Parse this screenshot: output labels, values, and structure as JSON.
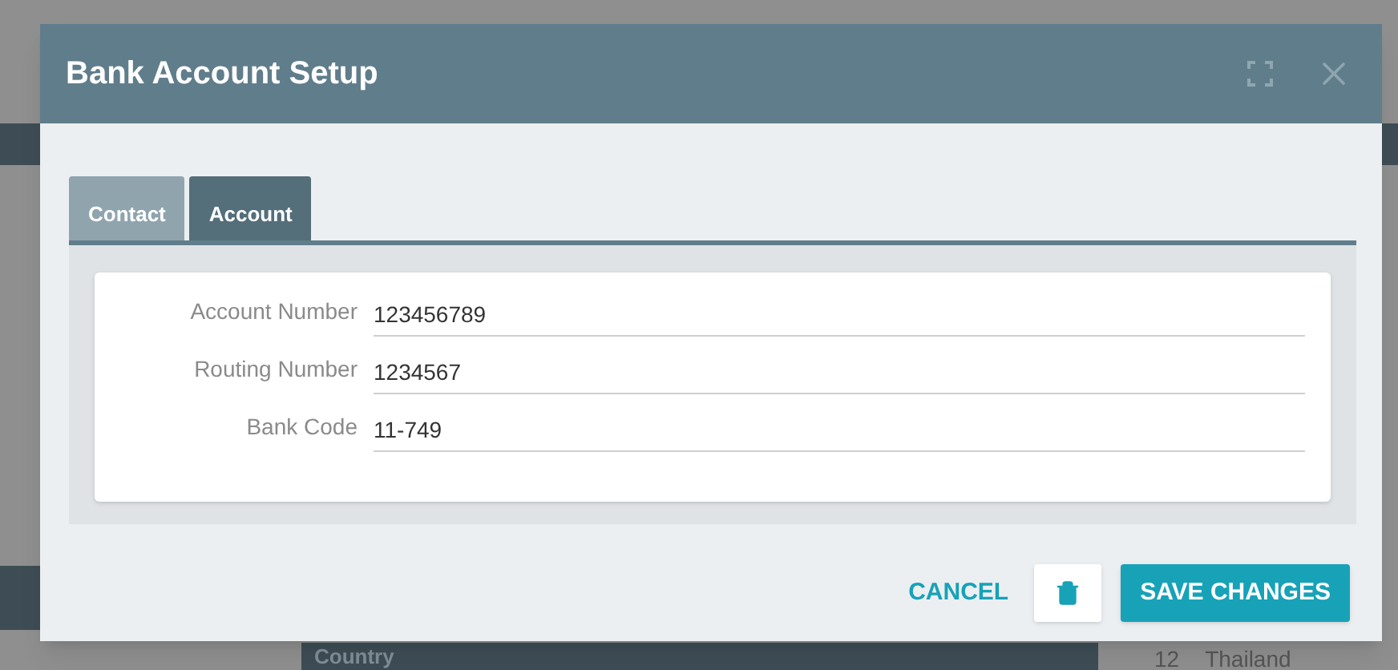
{
  "background": {
    "table_header": "Country",
    "row": {
      "number": "12",
      "country": "Thailand"
    }
  },
  "dialog": {
    "title": "Bank Account Setup",
    "tabs": [
      {
        "label": "Contact",
        "selected": false
      },
      {
        "label": "Account",
        "selected": true
      }
    ],
    "fields": [
      {
        "label": "Account Number",
        "value": "123456789"
      },
      {
        "label": "Routing Number",
        "value": "1234567"
      },
      {
        "label": "Bank Code",
        "value": "11-749"
      }
    ],
    "buttons": {
      "cancel": "CANCEL",
      "save": "SAVE CHANGES"
    }
  }
}
